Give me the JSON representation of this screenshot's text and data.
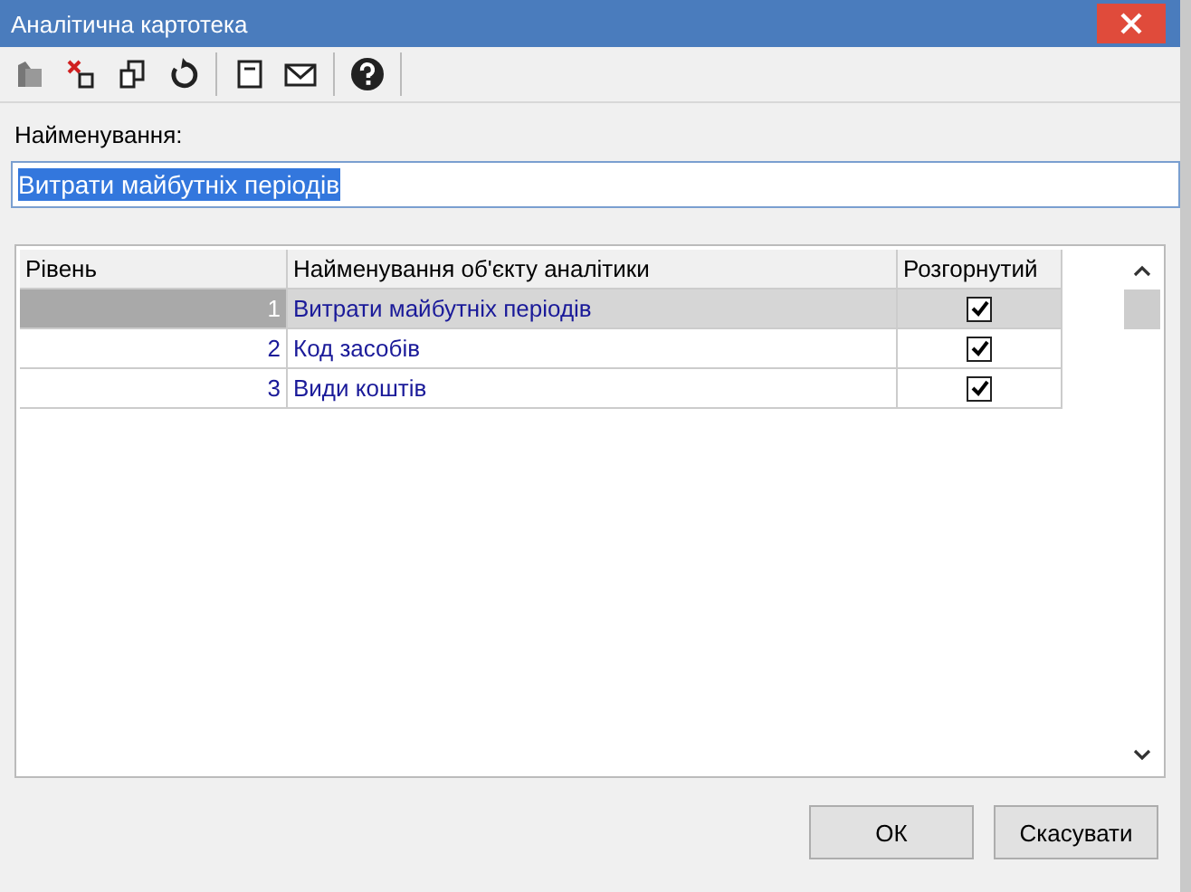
{
  "window": {
    "title": "Аналітична картотека"
  },
  "name_field": {
    "label": "Найменування:",
    "value": "Витрати майбутніх періодів",
    "text_selected": true
  },
  "table": {
    "columns": [
      "Рівень",
      "Найменування об'єкту аналітики",
      "Розгорнутий"
    ],
    "rows": [
      {
        "level": "1",
        "name": "Витрати майбутніх періодів",
        "expanded": true,
        "selected": true
      },
      {
        "level": "2",
        "name": "Код засобів",
        "expanded": true,
        "selected": false
      },
      {
        "level": "3",
        "name": "Види коштів",
        "expanded": true,
        "selected": false
      }
    ]
  },
  "buttons": [
    "ОК",
    "Скасувати"
  ]
}
